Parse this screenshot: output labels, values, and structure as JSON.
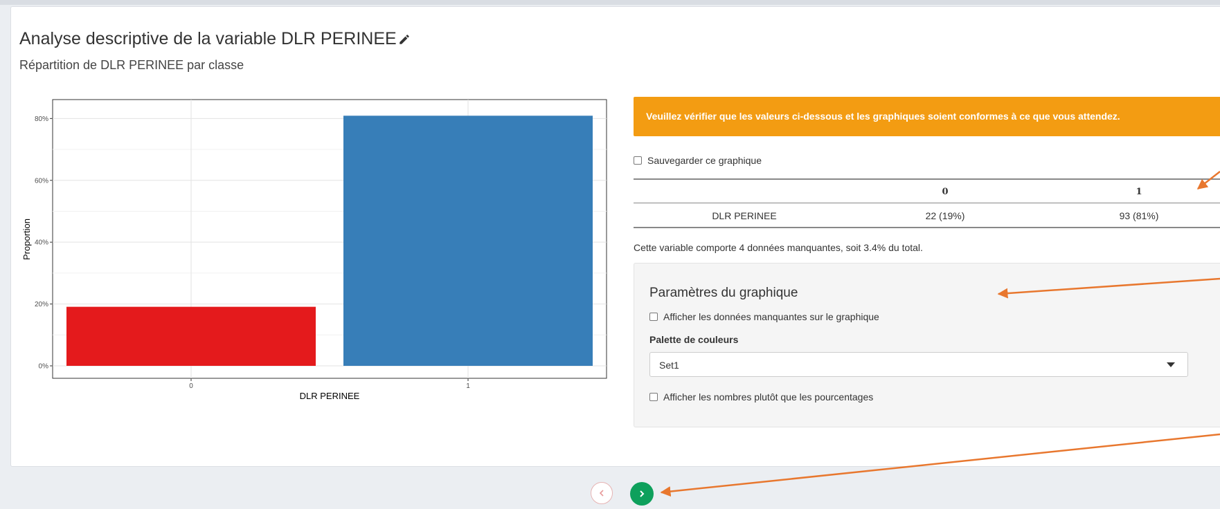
{
  "page": {
    "title": "Analyse descriptive de la variable DLR PERINEE",
    "subtitle": "Répartition de DLR PERINEE par classe"
  },
  "alert": {
    "text": "Veuillez vérifier que les valeurs ci-dessous et les graphiques soient conformes à ce que vous attendez.",
    "color": "#f39c12"
  },
  "save_checkbox": {
    "label": "Sauvegarder ce graphique",
    "checked": false
  },
  "summary_table": {
    "headers": [
      "",
      "0",
      "1"
    ],
    "rows": [
      [
        "DLR PERINEE",
        "22 (19%)",
        "93 (81%)"
      ]
    ]
  },
  "missing_text": "Cette variable comporte 4 données manquantes, soit 3.4% du total.",
  "params": {
    "title": "Paramètres du graphique",
    "show_missing": {
      "label": "Afficher les données manquantes sur le graphique",
      "checked": false
    },
    "palette_label": "Palette de couleurs",
    "palette_value": "Set1",
    "show_counts": {
      "label": "Afficher les nombres plutôt que les pourcentages",
      "checked": false
    }
  },
  "nav": {
    "prev_icon": "chevron-left-icon",
    "next_icon": "chevron-right-icon"
  },
  "chart_data": {
    "type": "bar",
    "categories": [
      "0",
      "1"
    ],
    "values": [
      19.1,
      80.9
    ],
    "colors": [
      "#e41a1c",
      "#377eb8"
    ],
    "xlabel": "DLR PERINEE",
    "ylabel": "Proportion",
    "ylim": [
      0,
      85
    ],
    "yticks": [
      0,
      20,
      40,
      60,
      80
    ],
    "ytick_labels": [
      "0%",
      "20%",
      "40%",
      "60%",
      "80%"
    ],
    "grid": true
  }
}
